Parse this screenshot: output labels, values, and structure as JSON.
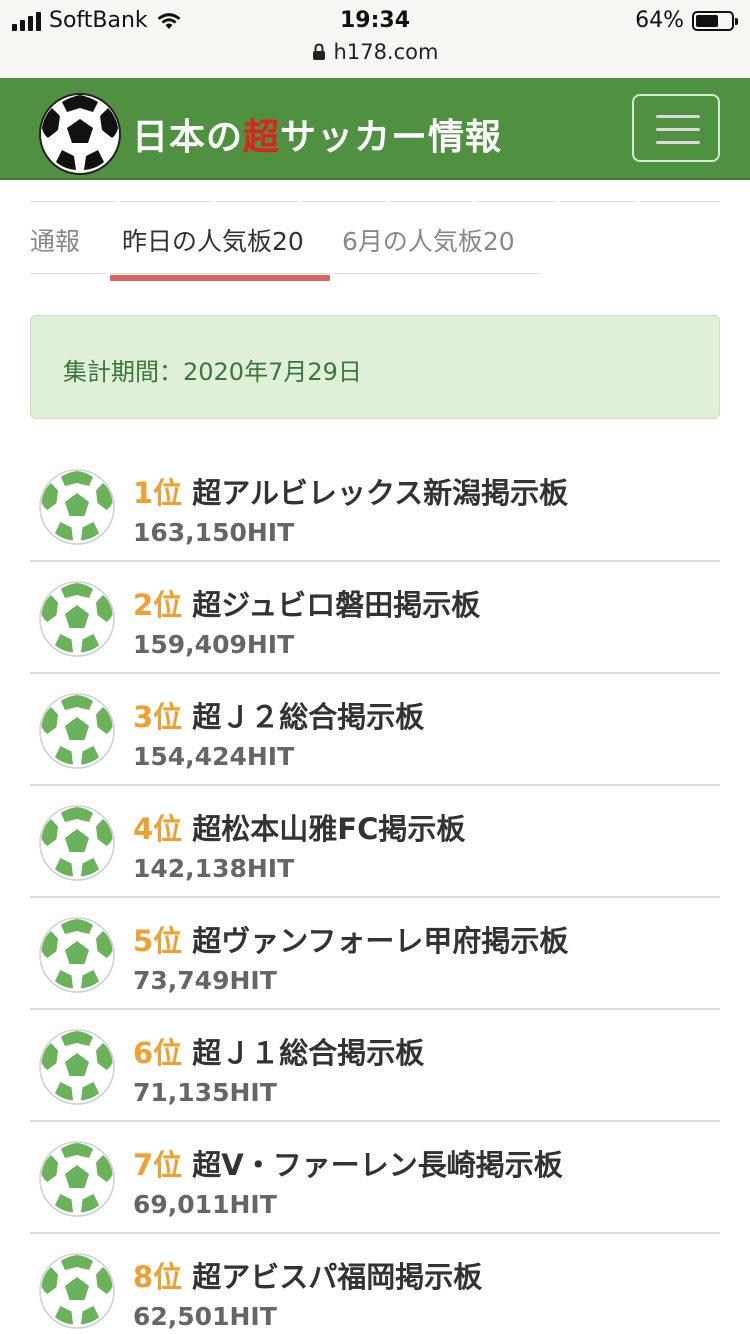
{
  "status_bar": {
    "carrier": "SoftBank",
    "time": "19:34",
    "battery": "64%",
    "battery_level": 0.64,
    "url": "h178.com"
  },
  "header": {
    "title_part1": "日本の",
    "title_accent": "超",
    "title_part2": "サッカー情報",
    "menu_icon": "hamburger-menu-icon",
    "colors": {
      "bar": "#4f9140",
      "accent": "#e0221f"
    }
  },
  "tabs": [
    {
      "label": "通報",
      "active": false
    },
    {
      "label": "昨日の人気板20",
      "active": true
    },
    {
      "label": "6月の人気板20",
      "active": false
    }
  ],
  "period": {
    "text": "集計期間：2020年7月29日"
  },
  "ranking": [
    {
      "rank": "1位",
      "name": "超アルビレックス新潟掲示板",
      "hits": "163,150HIT"
    },
    {
      "rank": "2位",
      "name": "超ジュビロ磐田掲示板",
      "hits": "159,409HIT"
    },
    {
      "rank": "3位",
      "name": "超Ｊ２総合掲示板",
      "hits": "154,424HIT"
    },
    {
      "rank": "4位",
      "name": "超松本山雅FC掲示板",
      "hits": "142,138HIT"
    },
    {
      "rank": "5位",
      "name": "超ヴァンフォーレ甲府掲示板",
      "hits": "73,749HIT"
    },
    {
      "rank": "6位",
      "name": "超Ｊ１総合掲示板",
      "hits": "71,135HIT"
    },
    {
      "rank": "7位",
      "name": "超V・ファーレン長崎掲示板",
      "hits": "69,011HIT"
    },
    {
      "rank": "8位",
      "name": "超アビスパ福岡掲示板",
      "hits": "62,501HIT"
    }
  ]
}
